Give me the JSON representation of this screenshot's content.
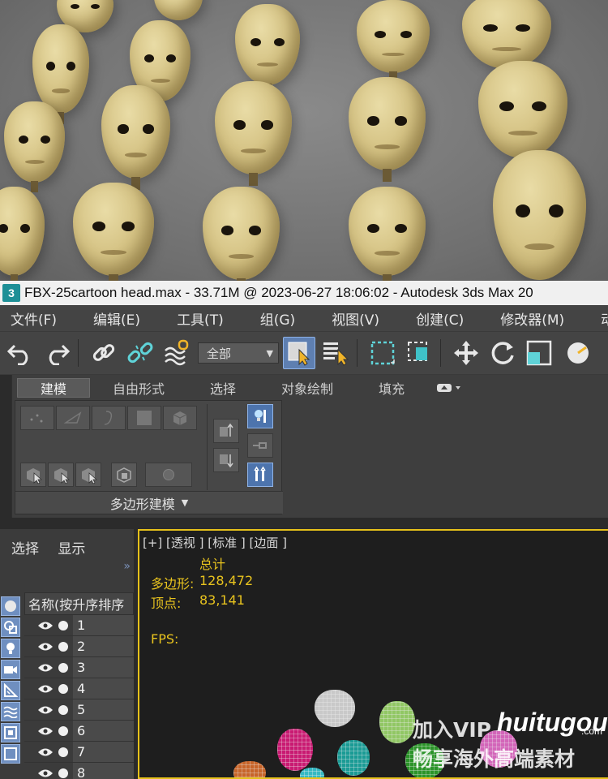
{
  "window": {
    "title": "FBX-25cartoon head.max - 33.71M @ 2023-06-27 18:06:02 - Autodesk 3ds Max 20",
    "app_icon_label": "3"
  },
  "menubar": [
    "文件(F)",
    "编辑(E)",
    "工具(T)",
    "组(G)",
    "视图(V)",
    "创建(C)",
    "修改器(M)",
    "动画(A)"
  ],
  "toolbar": {
    "selection_filter": "全部",
    "icons": [
      "undo-icon",
      "redo-icon",
      "link-icon",
      "unlink-icon",
      "bind-space-warp-icon",
      "select-object-icon",
      "select-by-name-icon",
      "rectangular-region-icon",
      "window-crossing-icon",
      "move-icon",
      "rotate-icon",
      "scale-icon"
    ]
  },
  "ribbon": {
    "tabs": [
      "建模",
      "自由形式",
      "选择",
      "对象绘制",
      "填充"
    ],
    "active_tab": "建模",
    "panel_label": "多边形建模"
  },
  "explorer": {
    "menu": [
      "选择",
      "显示"
    ],
    "column_header": "名称(按升序排序",
    "rows": [
      "1",
      "2",
      "3",
      "4",
      "5",
      "6",
      "7",
      "8"
    ]
  },
  "viewport": {
    "label": "[+] [透视 ] [标准 ] [边面 ]",
    "stats": {
      "header": "总计",
      "polygons_label": "多边形:",
      "polygons_value": "128,472",
      "vertices_label": "顶点:",
      "vertices_value": "83,141",
      "fps_label": "FPS:"
    },
    "accent_color": "#e6c11a"
  },
  "watermark": {
    "line1": "加入VIP",
    "line2": "畅享海外高端素材",
    "logo": "huitugou",
    "logo_suffix": ".com"
  }
}
